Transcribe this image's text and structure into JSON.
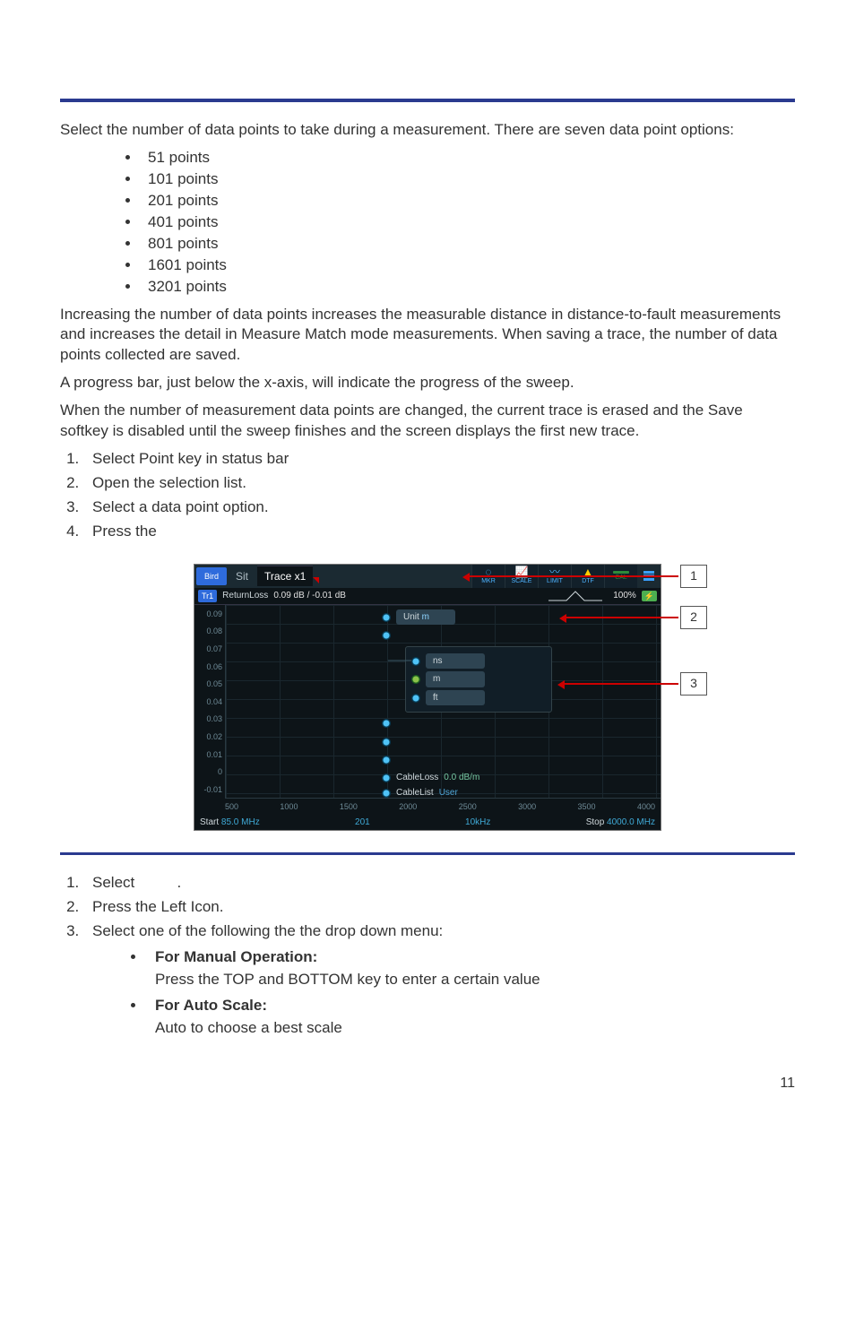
{
  "intro": "Select the number of data points to take during a measurement. There are seven data point options:",
  "bullets": [
    "51 points",
    "101 points",
    "201 points",
    "401 points",
    "801 points",
    "1601 points",
    "3201 points"
  ],
  "para1": "Increasing the number of data points increases the measurable distance in distance-to-fault measurements and increases the detail in Measure Match mode measurements. When saving a trace, the number of data points collected are saved.",
  "para2": "A progress bar, just below the x-axis, will indicate the progress of the sweep.",
  "para3": "When the number of measurement data points are changed, the current trace is erased and the Save softkey is disabled until the sweep finishes and the screen displays the first new trace.",
  "stepsA": [
    "Select Point key in status bar",
    "Open the selection list.",
    "Select a data point option.",
    "Press the"
  ],
  "stepsB": [
    "Select",
    "Press the Left Icon.",
    "Select one of the following the the drop down menu:"
  ],
  "stepB1_suffix": ".",
  "sub1_head": "For Manual Operation:",
  "sub1_body": "Press the TOP and BOTTOM key to enter a certain value",
  "sub2_head": "For Auto Scale:",
  "sub2_body": "Auto to choose a best scale",
  "page_num": "11",
  "chart_data": {
    "type": "line",
    "title_bar": {
      "brand": "Bird",
      "mode": "Sit",
      "trace": "Trace x1",
      "icons": [
        "MKR",
        "SCALE",
        "LIMIT",
        "DTF",
        "CAL"
      ],
      "battery": true
    },
    "info_row": {
      "trace_id": "Tr1",
      "measure": "ReturnLoss",
      "value": "0.09 dB / -0.01 dB",
      "percent": "100%"
    },
    "y_ticks": [
      "0.09",
      "0.08",
      "0.07",
      "0.06",
      "0.05",
      "0.04",
      "0.03",
      "0.02",
      "0.01",
      "0",
      "-0.01"
    ],
    "x_ticks": [
      "500",
      "1000",
      "1500",
      "2000",
      "2500",
      "3000",
      "3500",
      "4000"
    ],
    "footer": {
      "start_label": "Start",
      "start_val": "85.0 MHz",
      "mid1": "201",
      "mid2": "10kHz",
      "stop_label": "Stop",
      "stop_val": "4000.0 MHz"
    },
    "menu": {
      "top_label": "Unit",
      "top_val": "m",
      "unit_options": [
        "ns",
        "m",
        "ft"
      ],
      "unit_selected": "m",
      "cable_loss_label": "CableLoss",
      "cable_loss_val": "0.0 dB/m",
      "cable_list_label": "CableList",
      "cable_list_val": "User"
    },
    "callouts": [
      "1",
      "2",
      "3"
    ]
  }
}
